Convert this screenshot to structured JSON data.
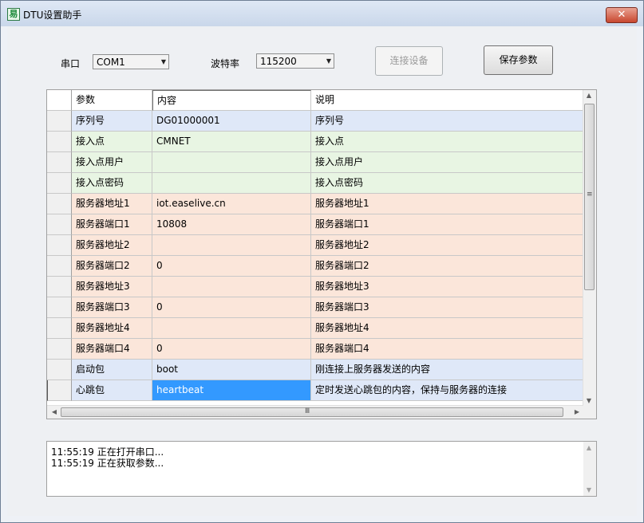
{
  "window": {
    "title": "DTU设置助手",
    "icon": "app-icon",
    "close_symbol": "✕"
  },
  "toolbar": {
    "port_label": "串口",
    "port_value": "COM1",
    "baud_label": "波特率",
    "baud_value": "115200",
    "connect_label": "连接设备",
    "save_label": "保存参数"
  },
  "grid": {
    "columns": [
      "参数",
      "内容",
      "说明"
    ],
    "rows": [
      {
        "param": "序列号",
        "value": "DG01000001",
        "desc": "序列号",
        "color": "#dfe8f8"
      },
      {
        "param": "接入点",
        "value": "CMNET",
        "desc": "接入点",
        "color": "#e8f5e3"
      },
      {
        "param": "接入点用户",
        "value": "",
        "desc": "接入点用户",
        "color": "#e8f5e3"
      },
      {
        "param": "接入点密码",
        "value": "",
        "desc": "接入点密码",
        "color": "#e8f5e3"
      },
      {
        "param": "服务器地址1",
        "value": "iot.easelive.cn",
        "desc": "服务器地址1",
        "color": "#fbe6da"
      },
      {
        "param": "服务器端口1",
        "value": "10808",
        "desc": "服务器端口1",
        "color": "#fbe6da"
      },
      {
        "param": "服务器地址2",
        "value": "",
        "desc": "服务器地址2",
        "color": "#fbe6da"
      },
      {
        "param": "服务器端口2",
        "value": "0",
        "desc": "服务器端口2",
        "color": "#fbe6da"
      },
      {
        "param": "服务器地址3",
        "value": "",
        "desc": "服务器地址3",
        "color": "#fbe6da"
      },
      {
        "param": "服务器端口3",
        "value": "0",
        "desc": "服务器端口3",
        "color": "#fbe6da"
      },
      {
        "param": "服务器地址4",
        "value": "",
        "desc": "服务器地址4",
        "color": "#fbe6da"
      },
      {
        "param": "服务器端口4",
        "value": "0",
        "desc": "服务器端口4",
        "color": "#fbe6da"
      },
      {
        "param": "启动包",
        "value": "boot",
        "desc": "刚连接上服务器发送的内容",
        "color": "#dfe8f8"
      },
      {
        "param": "心跳包",
        "value": "heartbeat",
        "desc": "定时发送心跳包的内容，保持与服务器的连接",
        "color": "#dfe8f8",
        "selected": true
      }
    ],
    "selected_color": "#3399ff",
    "scroll_up": "▲",
    "scroll_down": "▼",
    "scroll_left": "◀",
    "scroll_right": "▶",
    "grip_v": "≡",
    "grip_h": "Ⅲ"
  },
  "log": {
    "lines": [
      "11:55:19  正在打开串口...",
      "11:55:19  正在获取参数..."
    ]
  }
}
